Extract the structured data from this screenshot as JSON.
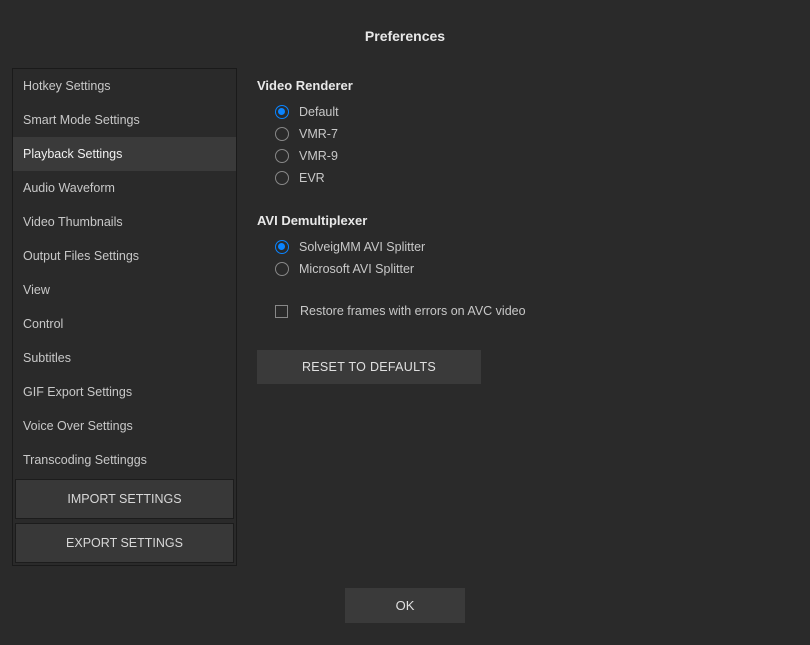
{
  "header": {
    "title": "Preferences"
  },
  "sidebar": {
    "items": [
      {
        "label": "Hotkey Settings",
        "selected": false
      },
      {
        "label": "Smart Mode Settings",
        "selected": false
      },
      {
        "label": "Playback Settings",
        "selected": true
      },
      {
        "label": "Audio Waveform",
        "selected": false
      },
      {
        "label": "Video Thumbnails",
        "selected": false
      },
      {
        "label": "Output Files Settings",
        "selected": false
      },
      {
        "label": "View",
        "selected": false
      },
      {
        "label": "Control",
        "selected": false
      },
      {
        "label": "Subtitles",
        "selected": false
      },
      {
        "label": "GIF Export Settings",
        "selected": false
      },
      {
        "label": "Voice Over Settings",
        "selected": false
      },
      {
        "label": "Transcoding Settinggs",
        "selected": false
      }
    ],
    "import_label": "IMPORT SETTINGS",
    "export_label": "EXPORT SETTINGS"
  },
  "main": {
    "video_renderer": {
      "title": "Video Renderer",
      "options": [
        {
          "label": "Default",
          "checked": true
        },
        {
          "label": "VMR-7",
          "checked": false
        },
        {
          "label": "VMR-9",
          "checked": false
        },
        {
          "label": "EVR",
          "checked": false
        }
      ]
    },
    "avi_demux": {
      "title": "AVI Demultiplexer",
      "options": [
        {
          "label": "SolveigMM AVI Splitter",
          "checked": true
        },
        {
          "label": "Microsoft AVI Splitter",
          "checked": false
        }
      ]
    },
    "restore_frames": {
      "label": "Restore frames with errors on AVC video",
      "checked": false
    },
    "reset_label": "RESET TO DEFAULTS"
  },
  "footer": {
    "ok_label": "OK"
  }
}
